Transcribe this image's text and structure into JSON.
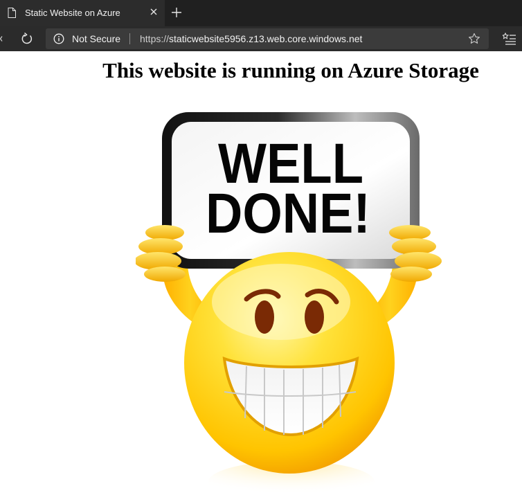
{
  "browser": {
    "tab_title": "Static Website on Azure",
    "security_label": "Not Secure",
    "url_scheme": "https://",
    "url_host": "staticwebsite5956.z13.web.core.windows.net",
    "icons": [
      "page-icon",
      "close-icon",
      "new-tab-icon",
      "reload-icon",
      "info-icon",
      "favorite-star-icon",
      "favorites-list-icon"
    ]
  },
  "page": {
    "heading": "This website is running on Azure Storage",
    "sign_line1": "WELL",
    "sign_line2": "DONE!"
  },
  "colors": {
    "tab_bar": "#202020",
    "active_tab": "#2c2c2c",
    "toolbar": "#2b2b2b",
    "address_bar": "#3b3b3b",
    "smiley_yellow": "#ffcc00",
    "eyes": "#7a2a05"
  }
}
